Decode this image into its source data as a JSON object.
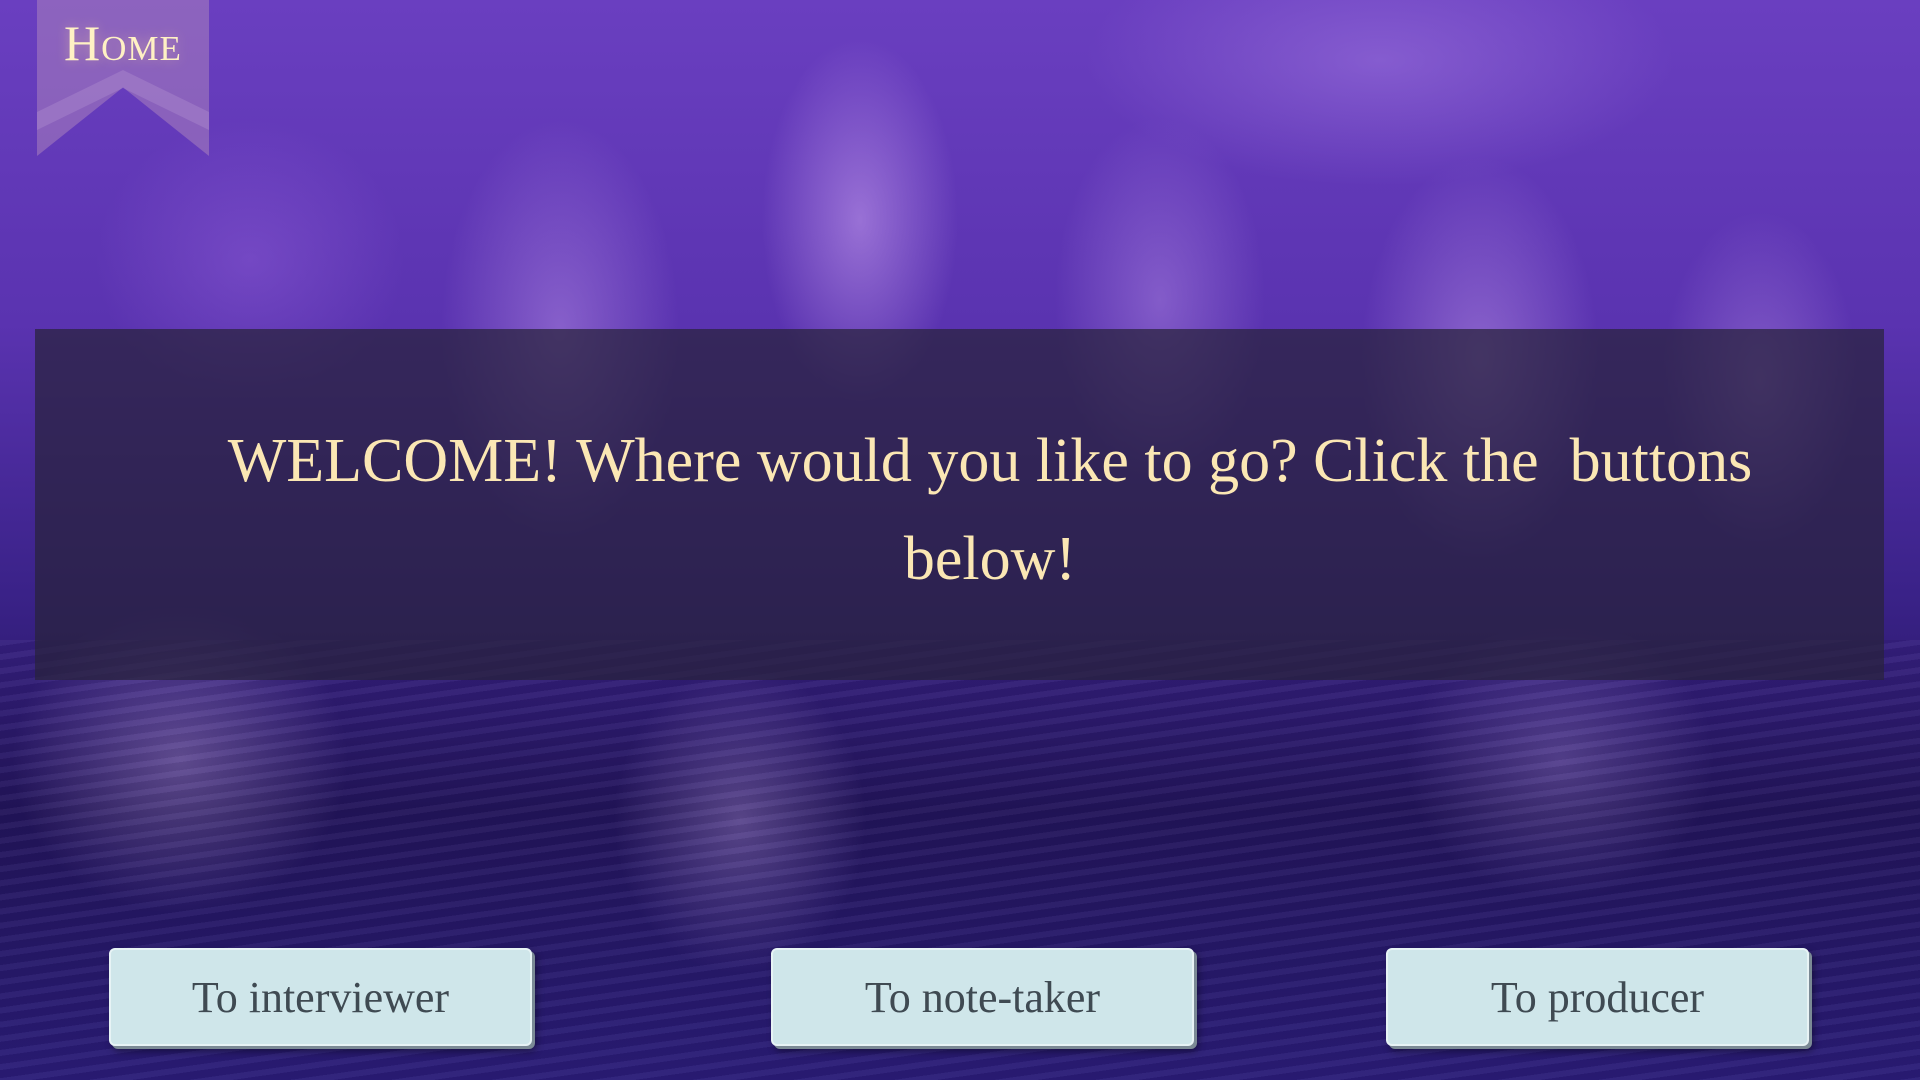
{
  "header": {
    "title": "Home"
  },
  "main": {
    "welcome_text": "WELCOME! Where would you like to go? Click the  buttons below!"
  },
  "buttons": [
    {
      "label": "To interviewer"
    },
    {
      "label": "To note-taker"
    },
    {
      "label": "To producer"
    }
  ],
  "colors": {
    "title_text": "#fff1c4",
    "welcome_text": "#fbe7b4",
    "button_bg": "#cfe6ea",
    "button_text": "#3f4a52",
    "banner_bg": "#28233c"
  }
}
